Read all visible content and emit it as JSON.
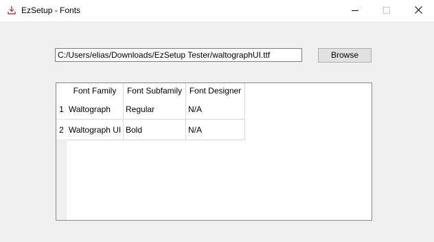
{
  "window": {
    "title": "EzSetup - Fonts"
  },
  "file": {
    "path": "C:/Users/elias/Downloads/EzSetup Tester/waltographUI.ttf",
    "browse_label": "Browse"
  },
  "table": {
    "columns": [
      "Font Family",
      "Font Subfamily",
      "Font Designer"
    ],
    "rows": [
      {
        "num": "1",
        "cells": [
          "Waltograph",
          "Regular",
          "N/A"
        ]
      },
      {
        "num": "2",
        "cells": [
          "Waltograph UI",
          "Bold",
          "N/A"
        ]
      }
    ]
  },
  "icons": {
    "app": "download-arrow-icon",
    "minimize": "minimize-icon",
    "maximize": "maximize-icon",
    "close": "close-icon"
  },
  "colors": {
    "app_icon": "#b0413e"
  }
}
